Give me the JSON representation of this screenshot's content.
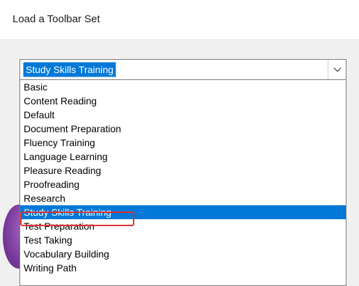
{
  "title": "Load a Toolbar Set",
  "combo": {
    "value": "Study Skills Training"
  },
  "options": [
    "Basic",
    "Content Reading",
    "Default",
    "Document Preparation",
    "Fluency Training",
    "Language Learning",
    "Pleasure Reading",
    "Proofreading",
    "Research",
    "Study Skills Training",
    "Test Preparation",
    "Test Taking",
    "Vocabulary Building",
    "Writing Path"
  ],
  "selected_index": 9,
  "colors": {
    "selection": "#0078d7",
    "highlight_box": "#e03030",
    "panel_background": "#f0f0f0"
  },
  "icons": {
    "dropdown_arrow": "chevron-down-icon"
  }
}
